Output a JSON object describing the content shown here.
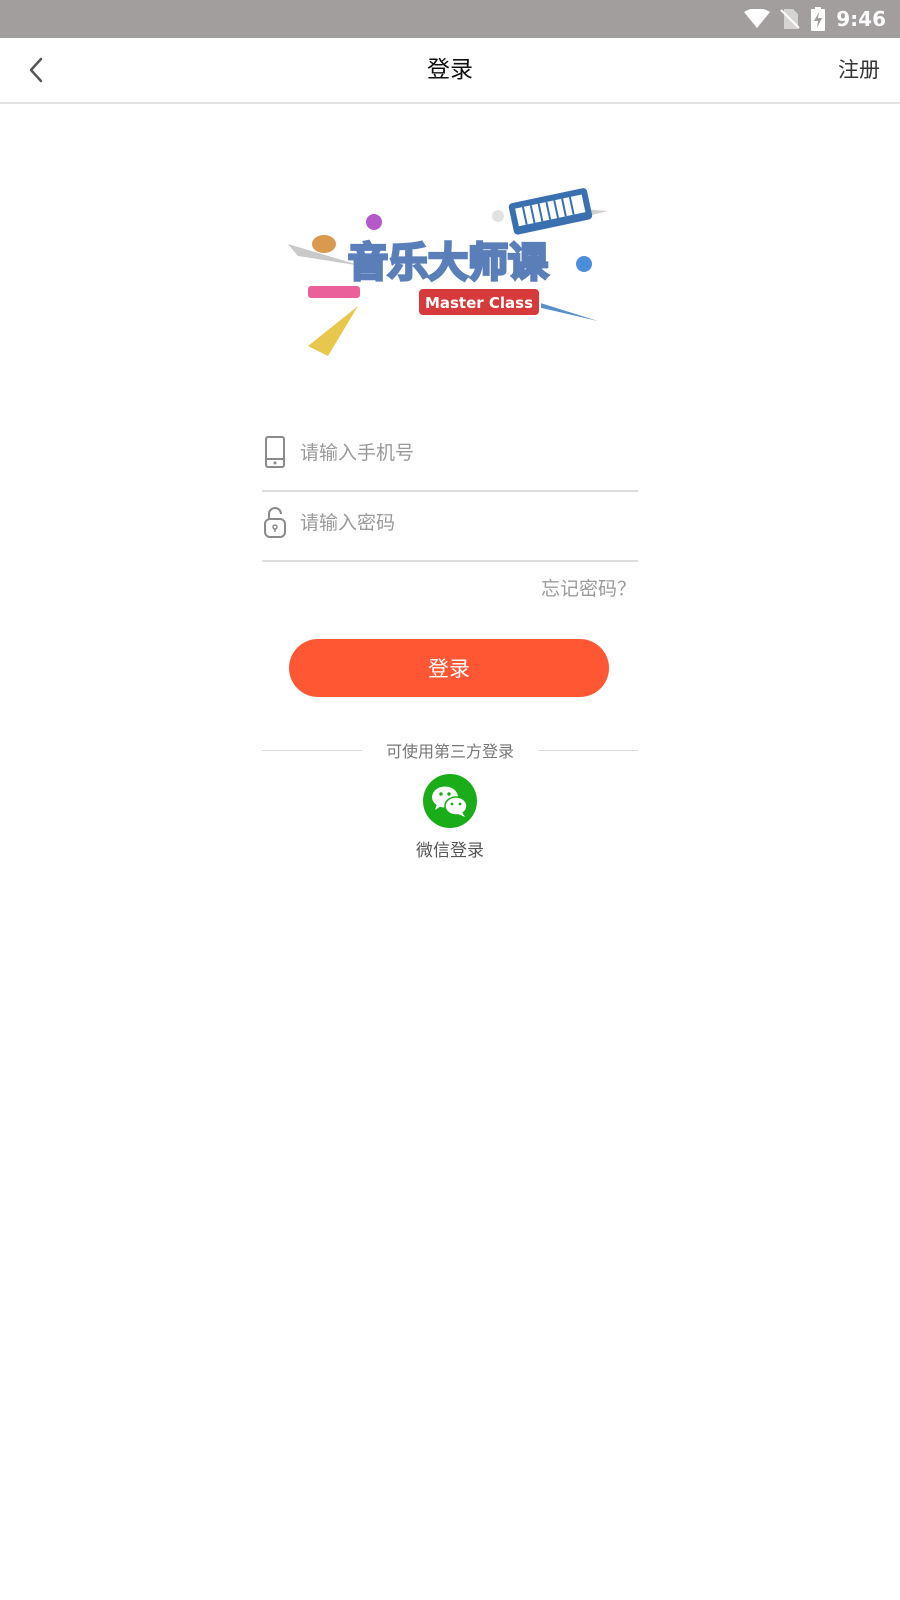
{
  "status_bar": {
    "time": "9:46",
    "icons": [
      "wifi-icon",
      "no-sim-icon",
      "battery-charging-icon"
    ]
  },
  "header": {
    "title": "登录",
    "register_label": "注册",
    "back_icon": "back-chevron-icon"
  },
  "logo": {
    "main_text": "音乐大师课",
    "sub_text": "Master Class"
  },
  "form": {
    "phone": {
      "placeholder": "请输入手机号",
      "value": "",
      "icon": "phone-icon"
    },
    "password": {
      "placeholder": "请输入密码",
      "value": "",
      "icon": "lock-icon"
    },
    "forgot_label": "忘记密码？",
    "login_label": "登录"
  },
  "third_party": {
    "label": "可使用第三方登录",
    "wechat_label": "微信登录",
    "wechat_icon": "wechat-icon"
  },
  "colors": {
    "accent": "#ff5733",
    "wechat": "#1aad19",
    "status_bar": "#a29e9e"
  }
}
